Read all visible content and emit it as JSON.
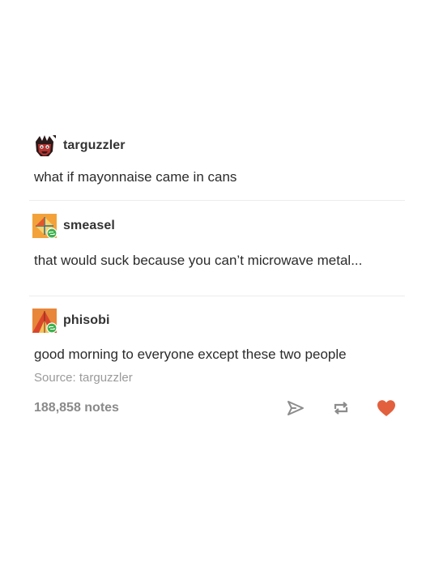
{
  "post": {
    "replies": [
      {
        "username": "targuzzler",
        "text": "what if mayonnaise came in cans",
        "avatar_icon": "dark-red-monster-avatar-icon"
      },
      {
        "username": "smeasel",
        "text": "that would suck because you can’t microwave metal...",
        "avatar_icon": "orange-geometric-avatar-icon"
      },
      {
        "username": "phisobi",
        "text": "good morning to everyone except these two people",
        "avatar_icon": "red-orange-geometric-avatar-icon"
      }
    ],
    "source": "Source: targuzzler",
    "notes": "188,858 notes",
    "actions": {
      "share_icon": "paper-plane-icon",
      "reblog_icon": "reblog-icon",
      "like_icon": "heart-icon"
    },
    "colors": {
      "heart": "#e2603d",
      "reblog_badge": "#3fb24f",
      "icon_gray": "#8c8c8c"
    }
  }
}
